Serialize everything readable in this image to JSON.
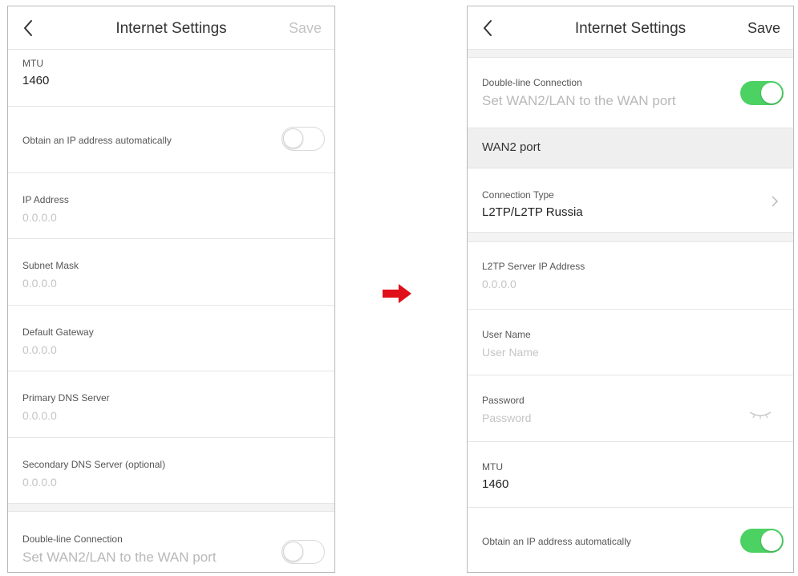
{
  "left": {
    "nav": {
      "title": "Internet Settings",
      "save": "Save"
    },
    "mtu": {
      "label": "MTU",
      "value": "1460"
    },
    "obtain_ip": {
      "label": "Obtain an IP address automatically",
      "enabled": false
    },
    "ip_address": {
      "label": "IP Address",
      "placeholder": "0.0.0.0"
    },
    "subnet_mask": {
      "label": "Subnet Mask",
      "placeholder": "0.0.0.0"
    },
    "default_gateway": {
      "label": "Default Gateway",
      "placeholder": "0.0.0.0"
    },
    "primary_dns": {
      "label": "Primary DNS Server",
      "placeholder": "0.0.0.0"
    },
    "secondary_dns": {
      "label": "Secondary DNS Server (optional)",
      "placeholder": "0.0.0.0"
    },
    "double_line": {
      "label": "Double-line Connection",
      "sublabel": "Set WAN2/LAN to the WAN port",
      "enabled": false
    }
  },
  "right": {
    "nav": {
      "title": "Internet Settings",
      "save": "Save"
    },
    "double_line": {
      "label": "Double-line Connection",
      "sublabel": "Set WAN2/LAN to the WAN port",
      "enabled": true
    },
    "section_header": "WAN2 port",
    "connection_type": {
      "label": "Connection Type",
      "value": "L2TP/L2TP Russia"
    },
    "l2tp_server": {
      "label": "L2TP Server IP Address",
      "placeholder": "0.0.0.0"
    },
    "user_name": {
      "label": "User Name",
      "placeholder": "User Name"
    },
    "password": {
      "label": "Password",
      "placeholder": "Password"
    },
    "mtu": {
      "label": "MTU",
      "value": "1460"
    },
    "obtain_ip": {
      "label": "Obtain an IP address automatically",
      "enabled": true
    }
  },
  "colors": {
    "toggle_on": "#4cd163",
    "arrow": "#e0101a",
    "placeholder": "#c4c4c4"
  },
  "icons": {
    "back": "chevron-left-icon",
    "arrow": "right-arrow-icon",
    "chevron": "chevron-right-icon",
    "eye": "eye-closed-icon"
  }
}
